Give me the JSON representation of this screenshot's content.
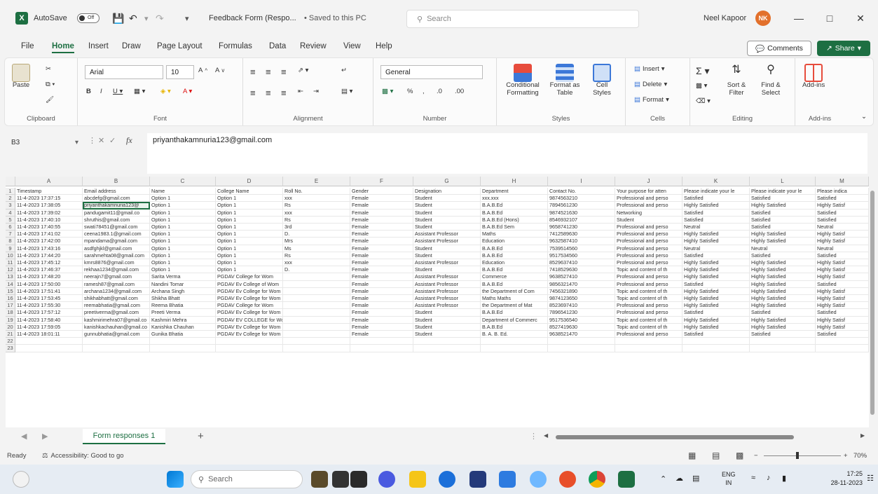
{
  "titlebar": {
    "autosave_label": "AutoSave",
    "autosave_state": "Off",
    "doc_title": "Feedback Form (Respo...",
    "saved_status": "• Saved to this PC",
    "search_placeholder": "Search",
    "user_name": "Neel Kapoor",
    "user_initials": "NK"
  },
  "menu": {
    "items": [
      "File",
      "Home",
      "Insert",
      "Draw",
      "Page Layout",
      "Formulas",
      "Data",
      "Review",
      "View",
      "Help"
    ],
    "active": "Home",
    "comments_label": "Comments",
    "share_label": "Share"
  },
  "ribbon": {
    "groups": {
      "clipboard": "Clipboard",
      "font": "Font",
      "alignment": "Alignment",
      "number": "Number",
      "styles": "Styles",
      "cells": "Cells",
      "editing": "Editing",
      "addins": "Add-ins"
    },
    "paste_label": "Paste",
    "font_name": "Arial",
    "font_size": "10",
    "number_format": "General",
    "conditional_formatting": "Conditional Formatting",
    "format_as_table": "Format as Table",
    "cell_styles": "Cell Styles",
    "insert": "Insert",
    "delete": "Delete",
    "format": "Format",
    "sort_filter": "Sort & Filter",
    "find_select": "Find & Select",
    "addins_btn": "Add-ins"
  },
  "formula_bar": {
    "name_box": "B3",
    "formula": "priyanthakamnuria123@gmail.com"
  },
  "grid": {
    "columns": [
      "A",
      "B",
      "C",
      "D",
      "E",
      "F",
      "G",
      "H",
      "I",
      "J",
      "K",
      "L",
      "M"
    ],
    "row_numbers": [
      "1",
      "2",
      "3",
      "4",
      "5",
      "6",
      "7",
      "8",
      "9",
      "10",
      "11",
      "12",
      "13",
      "14",
      "15",
      "16",
      "17",
      "18",
      "19",
      "20",
      "21",
      "22",
      "23"
    ],
    "header_row": [
      "Timestamp",
      "Email address",
      "Name",
      "College Name",
      "Roll No.",
      "Gender",
      "Designation",
      "Department",
      "Contact No.",
      "Your purpose for atten",
      "Please indicate your le",
      "Please indicate your le",
      "Please indica"
    ],
    "rows": [
      [
        "11-4-2023 17:37:15",
        "abcdefg@gmail.com",
        "Option 1",
        "Option 1",
        "xxx",
        "Female",
        "Student",
        "xxx.xxx",
        "9874563210",
        "Professional and perso",
        "Satisfied",
        "Satisfied",
        "Satisfied"
      ],
      [
        "11-4-2023 17:38:05",
        "priyanthakamnuria123@",
        "Option 1",
        "Option 1",
        "Rs",
        "Female",
        "Student",
        "B.A.B.Ed",
        "7894561230",
        "Professional and perso",
        "Highly Satisfied",
        "Highly Satisfied",
        "Highly Satisf"
      ],
      [
        "11-4-2023 17:39:02",
        "pandugamit11@gmail.co",
        "Option 1",
        "Option 1",
        "xxx",
        "Female",
        "Student",
        "B.A.B.Ed",
        "9874521630",
        "Networking",
        "Satisfied",
        "Satisfied",
        "Satisfied"
      ],
      [
        "11-4-2023 17:40:10",
        "shruthis@gmail.com",
        "Option 1",
        "Option 1",
        "Rs",
        "Female",
        "Student",
        "B.A.B.Ed (Hons)",
        "8546932107",
        "Student",
        "Satisfied",
        "Satisfied",
        "Satisfied"
      ],
      [
        "11-4-2023 17:40:55",
        "swati78451@gmail.com",
        "Option 1",
        "Option 1",
        "3rd",
        "Female",
        "Student",
        "B.A.B.Ed Sem",
        "9658741230",
        "Professional and perso",
        "Neutral",
        "Satisfied",
        "Neutral"
      ],
      [
        "11-4-2023 17:41:02",
        "ceena1983.1@gmail.com",
        "Option 1",
        "Option 1",
        "D.",
        "Female",
        "Assistant Professor",
        "Maths",
        "7412589630",
        "Professional and perso",
        "Highly Satisfied",
        "Highly Satisfied",
        "Highly Satisf"
      ],
      [
        "11-4-2023 17:42:00",
        "mpandama@gmail.com",
        "Option 1",
        "Option 1",
        "Mrs",
        "Female",
        "Assistant Professor",
        "Education",
        "9632587410",
        "Professional and perso",
        "Highly Satisfied",
        "Highly Satisfied",
        "Highly Satisf"
      ],
      [
        "11-4-2023 17:43:16",
        "asdfghjkl@gmail.com",
        "Option 1",
        "Option 1",
        "Ms",
        "Female",
        "Student",
        "B.A.B.Ed",
        "7539514560",
        "Professional and perso",
        "Neutral",
        "Neutral",
        "Neutral"
      ],
      [
        "11-4-2023 17:44:20",
        "sarahmehta08@gmail.com",
        "Option 1",
        "Option 1",
        "Rs",
        "Female",
        "Student",
        "B.A.B.Ed",
        "9517534560",
        "Professional and perso",
        "Satisfied",
        "Satisfied",
        "Satisfied"
      ],
      [
        "11-4-2023 17:45:12",
        "kmrs8876@gmail.com",
        "Option 1",
        "Option 1",
        "xxx",
        "Female",
        "Assistant Professor",
        "Education",
        "8529637410",
        "Professional and perso",
        "Highly Satisfied",
        "Highly Satisfied",
        "Highly Satisf"
      ],
      [
        "11-4-2023 17:46:37",
        "rekhaa1234@gmail.com",
        "Option 1",
        "Option 1",
        "D.",
        "Female",
        "Student",
        "B.A.B.Ed",
        "7418529630",
        "Topic and content of th",
        "Highly Satisfied",
        "Highly Satisfied",
        "Highly Satisf"
      ],
      [
        "11-4-2023 17:48:20",
        "neerajn7@gmail.com",
        "Sarita Verma",
        "PGDAV College for Wom",
        "",
        "Female",
        "Assistant Professor",
        "Commerce",
        "9638527410",
        "Professional and perso",
        "Highly Satisfied",
        "Highly Satisfied",
        "Highly Satisf"
      ],
      [
        "11-4-2023 17:50:00",
        "ramesh87@gmail.com",
        "Nandini Tomar",
        "PGDAV Ev College of Wom",
        "",
        "Female",
        "Assistant Professor",
        "B.A.B.Ed",
        "9856321470",
        "Professional and perso",
        "Satisfied",
        "Highly Satisfied",
        "Satisfied"
      ],
      [
        "11-4-2023 17:51:41",
        "archana1234@gmail.com",
        "Archana Singh",
        "PGDAV Ev College for Wom",
        "",
        "Female",
        "Assistant Professor",
        "the Department of Com",
        "7456321890",
        "Topic and content of th",
        "Highly Satisfied",
        "Highly Satisfied",
        "Highly Satisf"
      ],
      [
        "11-4-2023 17:53:45",
        "shikhabhatt@gmail.com",
        "Shikha Bhatt",
        "PGDAV Ev College for Wom",
        "",
        "Female",
        "Assistant Professor",
        "Maths Maths",
        "9874123650",
        "Topic and content of th",
        "Highly Satisfied",
        "Highly Satisfied",
        "Highly Satisf"
      ],
      [
        "11-4-2023 17:55:30",
        "reemabhatia@gmail.com",
        "Reema Bhatia",
        "PGDAV College for Wom",
        "",
        "Female",
        "Assistant Professor",
        "the Department of Mat",
        "8523697410",
        "Professional and perso",
        "Highly Satisfied",
        "Highly Satisfied",
        "Highly Satisf"
      ],
      [
        "11-4-2023 17:57:12",
        "preetiverma@gmail.com",
        "Preeti Verma",
        "PGDAV Ev College for Wom",
        "",
        "Female",
        "Student",
        "B.A.B.Ed",
        "7896541230",
        "Professional and perso",
        "Satisfied",
        "Satisfied",
        "Satisfied"
      ],
      [
        "11-4-2023 17:58:40",
        "kashmirimehra07@gmail.co",
        "Kashmiri Mehra",
        "PGDAV EV COLLEGE for Wom",
        "",
        "Female",
        "Student",
        "Department of Commerc",
        "9517536540",
        "Topic and content of th",
        "Highly Satisfied",
        "Highly Satisfied",
        "Highly Satisf"
      ],
      [
        "11-4-2023 17:59:05",
        "kanishkachauhan@gmail.co",
        "Kanishka Chauhan",
        "PGDAV Ev College for Wom",
        "",
        "Female",
        "Student",
        "B.A.B.Ed",
        "8527419630",
        "Topic and content of th",
        "Highly Satisfied",
        "Highly Satisfied",
        "Highly Satisf"
      ],
      [
        "11-4-2023 18:01:11",
        "gunnubhatia@gmail.com",
        "Gunika Bhatia",
        "PGDAV Ev College for Wom",
        "",
        "Female",
        "Student",
        "B. A. B. Ed.",
        "9638521470",
        "Professional and perso",
        "Satisfied",
        "Satisfied",
        "Satisfied"
      ]
    ]
  },
  "sheets": {
    "active": "Form responses 1",
    "add": "+"
  },
  "status": {
    "ready": "Ready",
    "accessibility": "Accessibility: Good to go",
    "zoom": "70%"
  },
  "taskbar": {
    "search_label": "Search",
    "lang_top": "ENG",
    "lang_bottom": "IN",
    "time": "17:25",
    "date": "28-11-2023"
  }
}
